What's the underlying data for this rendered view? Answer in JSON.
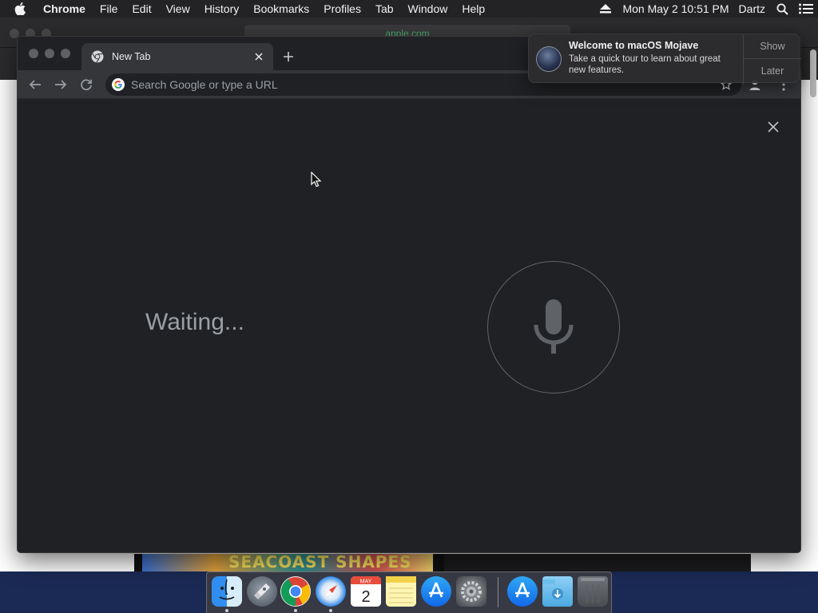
{
  "menubar": {
    "app_name": "Chrome",
    "items": [
      "File",
      "Edit",
      "View",
      "History",
      "Bookmarks",
      "Profiles",
      "Tab",
      "Window",
      "Help"
    ],
    "datetime": "Mon May 2  10:51 PM",
    "user": "Dartz",
    "status_icons": [
      "eject-icon",
      "spotlight-search-icon",
      "notification-center-icon"
    ]
  },
  "background_window": {
    "url": "apple.com",
    "banner_text": "SEACOAST SHAPES"
  },
  "chrome": {
    "tab": {
      "title": "New Tab",
      "favicon": "chrome-icon"
    },
    "omnibox": {
      "placeholder": "Search Google or type a URL",
      "value": ""
    },
    "content": {
      "status_text": "Waiting...",
      "mic_icon": "microphone-icon"
    }
  },
  "notification": {
    "title": "Welcome to macOS Mojave",
    "body": "Take a quick tour to learn about great new features.",
    "buttons": [
      "Show",
      "Later"
    ]
  },
  "dock": {
    "apps": [
      "Finder",
      "Launchpad",
      "Google Chrome",
      "Safari",
      "Calendar",
      "Notes",
      "App Store",
      "System Preferences",
      "App Store",
      "Downloads",
      "Trash"
    ],
    "calendar_month": "MAY",
    "calendar_day": "2"
  }
}
